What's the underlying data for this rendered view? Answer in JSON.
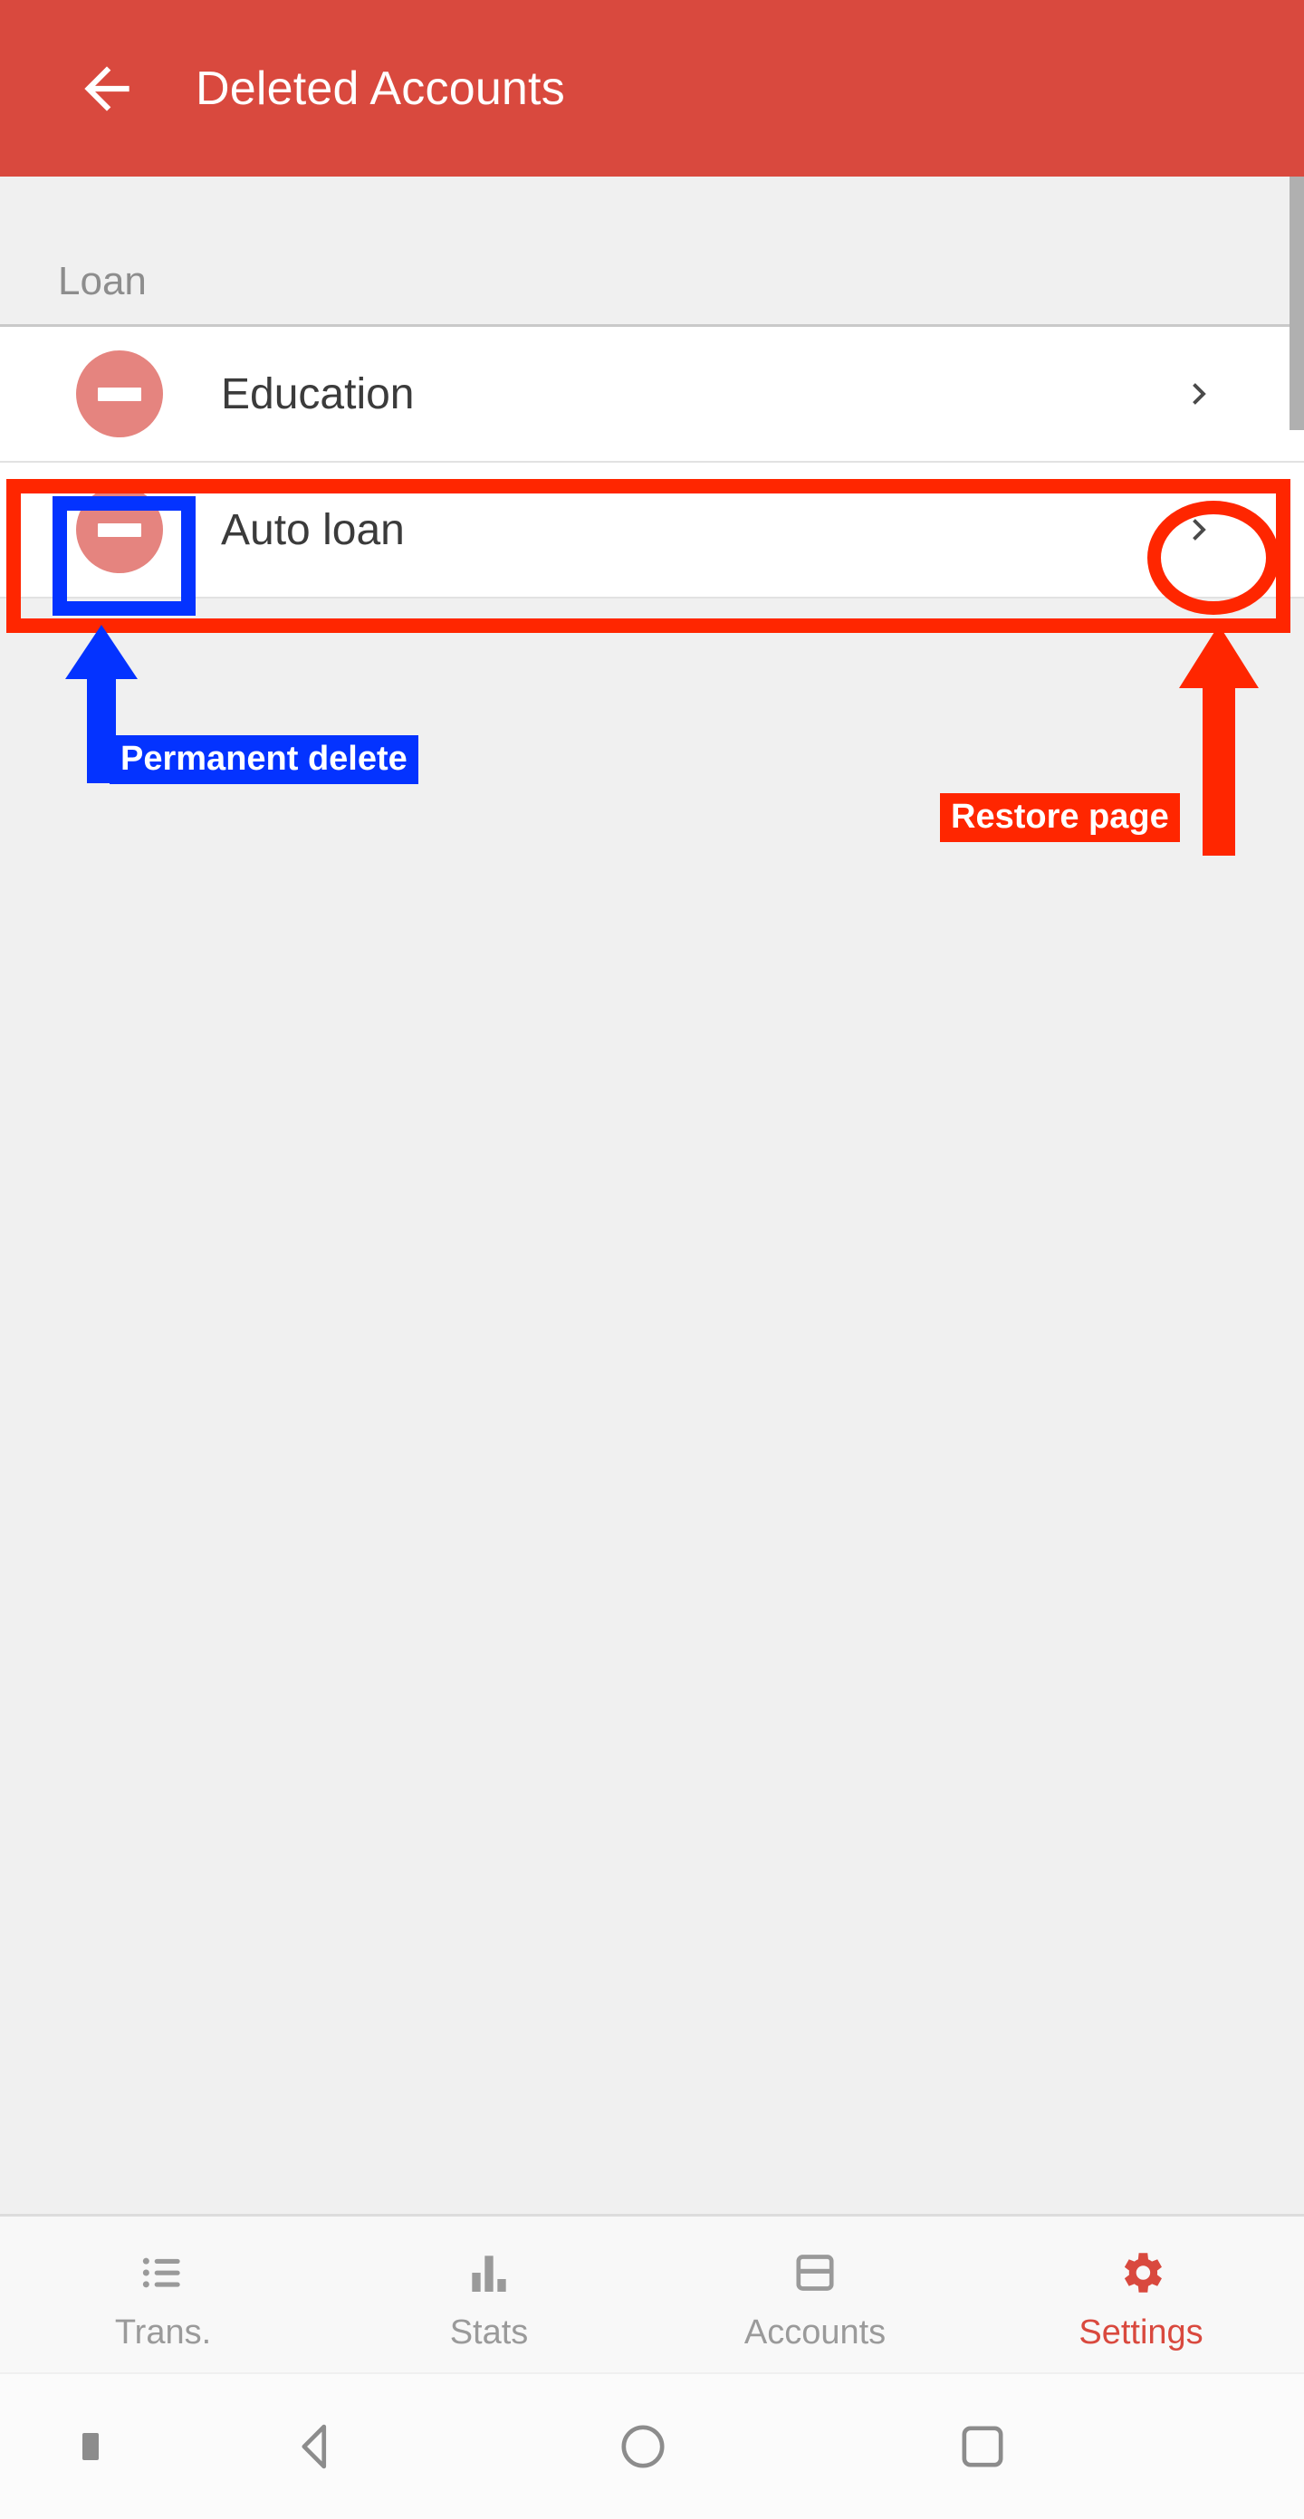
{
  "appbar": {
    "back_icon": "arrow-left-icon",
    "title": "Deleted Accounts",
    "background_color": "#d9493e"
  },
  "content": {
    "sections": [
      {
        "label": "Loan",
        "rows": [
          {
            "icon": "minus-circle-icon",
            "label": "Education",
            "chevron": "chevron-right-icon"
          },
          {
            "icon": "minus-circle-icon",
            "label": "Auto loan",
            "chevron": "chevron-right-icon"
          }
        ]
      }
    ],
    "scrollbar_visible": true,
    "background_color": "#f0f0f0",
    "row_icon_color": "#e5847f"
  },
  "annotations": [
    {
      "id": "permanent-delete",
      "label": "Permanent delete",
      "color": "#0433ff",
      "shape": "rectangle",
      "target": "minus-circle-icon on Auto loan row"
    },
    {
      "id": "restore-page",
      "label": "Restore page",
      "color": "#ff2600",
      "shape": "ellipse",
      "target": "chevron-right-icon on Auto loan row"
    },
    {
      "id": "auto-loan-row-highlight",
      "label": "",
      "color": "#ff2600",
      "shape": "rectangle",
      "target": "Auto loan row"
    }
  ],
  "tabbar": {
    "active_color": "#d9493e",
    "inactive_color": "#9a9a9a",
    "tabs": [
      {
        "icon": "list-icon",
        "label": "Trans.",
        "active": false
      },
      {
        "icon": "bar-chart-icon",
        "label": "Stats",
        "active": false
      },
      {
        "icon": "credit-card-icon",
        "label": "Accounts",
        "active": false
      },
      {
        "icon": "gear-icon",
        "label": "Settings",
        "active": true
      }
    ]
  },
  "sysnav": {
    "items": [
      {
        "icon": "dot-indicator-icon"
      },
      {
        "icon": "android-back-icon"
      },
      {
        "icon": "android-home-icon"
      },
      {
        "icon": "android-recents-icon"
      }
    ]
  }
}
